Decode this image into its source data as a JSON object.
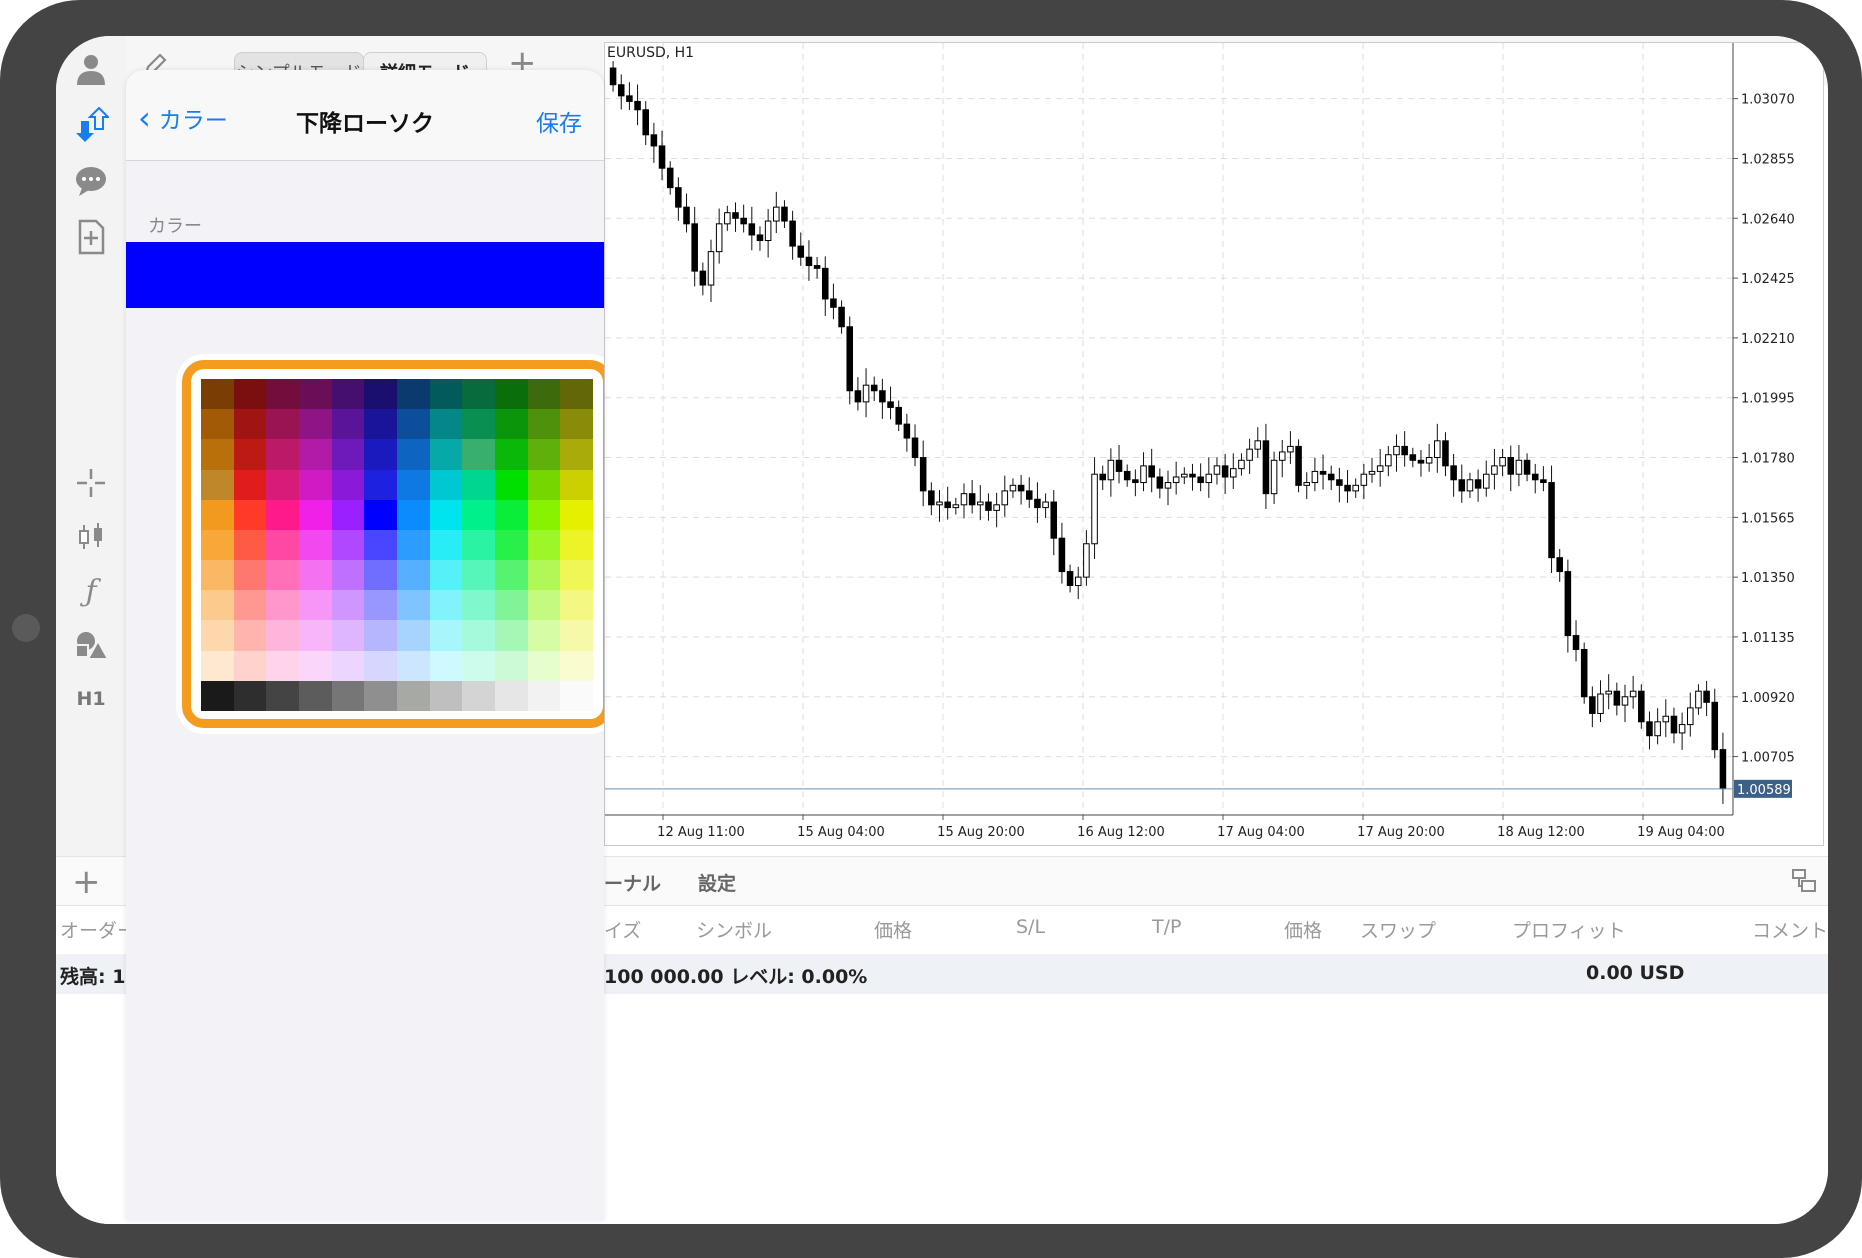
{
  "toolbar": {
    "simple_mode": "シンプルモード",
    "detail_mode": "詳細モード"
  },
  "sidebar": {
    "timeframe": "H1"
  },
  "panel": {
    "back_label": "カラー",
    "title": "下降ローソク",
    "save_label": "保存",
    "section_label": "カラー",
    "selected_color": "#0000ff"
  },
  "palette": [
    [
      "#7a3d04",
      "#7b0f0f",
      "#720d3c",
      "#6a0e57",
      "#440f6e",
      "#1a0f6e",
      "#0a3a6e",
      "#035a5a",
      "#086b3e",
      "#0a6e0a",
      "#3d6a0a",
      "#646707"
    ],
    [
      "#a25a07",
      "#a01414",
      "#9a1453",
      "#8f1486",
      "#5a149a",
      "#1a149a",
      "#0b4e99",
      "#038787",
      "#0a8f52",
      "#0a950a",
      "#4f910a",
      "#8a8c09"
    ],
    [
      "#b9700a",
      "#be1a14",
      "#bc1a68",
      "#b21aa8",
      "#6e1aba",
      "#1a1abe",
      "#0e64c1",
      "#06a8a8",
      "#38b06c",
      "#0ab80a",
      "#5fb00a",
      "#a9ab0a"
    ],
    [
      "#c0862a",
      "#e01c1c",
      "#d81a78",
      "#d01ac4",
      "#8a1ad8",
      "#1e22e0",
      "#0f79e3",
      "#00c8d2",
      "#00d690",
      "#00e000",
      "#76d600",
      "#ccd000"
    ],
    [
      "#f29a1e",
      "#ff3a28",
      "#ff1a8c",
      "#f020e8",
      "#9a20ff",
      "#0000ff",
      "#0a8cff",
      "#00e4f0",
      "#00f08c",
      "#0aee3a",
      "#88f200",
      "#e4f000"
    ],
    [
      "#f8a838",
      "#ff5a44",
      "#ff48a4",
      "#f248f0",
      "#b048ff",
      "#4846ff",
      "#2c9cff",
      "#28ecf6",
      "#28f4a4",
      "#28f048",
      "#9cf628",
      "#ecf428"
    ],
    [
      "#fab864",
      "#ff7870",
      "#ff70b8",
      "#f472f2",
      "#c070ff",
      "#706eff",
      "#56b0ff",
      "#56f0f8",
      "#56f6b8",
      "#56f270",
      "#b0f856",
      "#f0f656"
    ],
    [
      "#fcca8c",
      "#ff9890",
      "#ff96cc",
      "#f696f6",
      "#d096ff",
      "#9896ff",
      "#80c4ff",
      "#80f4fa",
      "#80f8cc",
      "#80f496",
      "#c4fa80",
      "#f4f880"
    ],
    [
      "#fdd8ac",
      "#ffb4ae",
      "#ffb4dc",
      "#f8b6f8",
      "#deb6ff",
      "#b6b6ff",
      "#a6d4ff",
      "#a6f6fc",
      "#a6fadc",
      "#a6f6b6",
      "#d6fca6",
      "#f6faa6"
    ],
    [
      "#fee8d0",
      "#ffd2ce",
      "#ffd4ea",
      "#fad6fa",
      "#ecd6ff",
      "#d6d6ff",
      "#cce6ff",
      "#ccfafe",
      "#ccfcec",
      "#ccfad6",
      "#e6fdcc",
      "#fafcd0"
    ],
    [
      "#1a1a1a",
      "#2e2e2e",
      "#444444",
      "#5c5c5c",
      "#767676",
      "#8f8f8f",
      "#a7a9a5",
      "#bfbfbf",
      "#d4d4d4",
      "#e6e6e6",
      "#f2f2f2",
      "#fafafa"
    ]
  ],
  "chart": {
    "title": "EURUSD, H1",
    "y_labels": [
      "1.03070",
      "1.02855",
      "1.02640",
      "1.02425",
      "1.02210",
      "1.01995",
      "1.01780",
      "1.01565",
      "1.01350",
      "1.01135",
      "1.00920",
      "1.00705"
    ],
    "current_price": "1.00589",
    "x_labels": [
      "12 Aug 11:00",
      "15 Aug 04:00",
      "15 Aug 20:00",
      "16 Aug 12:00",
      "17 Aug 04:00",
      "17 Aug 20:00",
      "18 Aug 12:00",
      "19 Aug 04:00"
    ]
  },
  "chart_data": {
    "type": "candlestick",
    "title": "EURUSD, H1",
    "ylim": [
      1.00495,
      1.0327
    ],
    "closes": [
      1.0312,
      1.0308,
      1.0306,
      1.0303,
      1.0294,
      1.029,
      1.0282,
      1.0275,
      1.0268,
      1.0262,
      1.0245,
      1.024,
      1.0252,
      1.0262,
      1.0266,
      1.0264,
      1.0262,
      1.0258,
      1.0256,
      1.0263,
      1.0268,
      1.0263,
      1.0254,
      1.025,
      1.0247,
      1.0246,
      1.0235,
      1.0232,
      1.0225,
      1.0202,
      1.0198,
      1.0204,
      1.0202,
      1.0198,
      1.0196,
      1.019,
      1.0185,
      1.0178,
      1.0166,
      1.0161,
      1.0162,
      1.016,
      1.0161,
      1.0165,
      1.0161,
      1.0162,
      1.0159,
      1.0161,
      1.0166,
      1.0168,
      1.0166,
      1.0163,
      1.016,
      1.0162,
      1.0149,
      1.0137,
      1.0132,
      1.0135,
      1.0147,
      1.0172,
      1.017,
      1.0177,
      1.0173,
      1.017,
      1.0169,
      1.0175,
      1.0171,
      1.0167,
      1.0169,
      1.0171,
      1.0172,
      1.0171,
      1.0169,
      1.0172,
      1.0175,
      1.0171,
      1.0174,
      1.0177,
      1.0181,
      1.0184,
      1.0165,
      1.0177,
      1.018,
      1.0182,
      1.0168,
      1.0169,
      1.0173,
      1.0172,
      1.017,
      1.0168,
      1.0166,
      1.0168,
      1.0172,
      1.0173,
      1.0175,
      1.0179,
      1.0182,
      1.0179,
      1.0177,
      1.0176,
      1.0178,
      1.0184,
      1.0175,
      1.017,
      1.0166,
      1.017,
      1.0167,
      1.0172,
      1.0175,
      1.0178,
      1.0172,
      1.0177,
      1.0172,
      1.017,
      1.0169,
      1.0142,
      1.0137,
      1.0114,
      1.0109,
      1.0092,
      1.0086,
      1.0093,
      1.0094,
      1.0089,
      1.0092,
      1.0094,
      1.0083,
      1.0078,
      1.0083,
      1.0085,
      1.0079,
      1.0082,
      1.0088,
      1.0094,
      1.009,
      1.0073,
      1.0059
    ]
  }
}
